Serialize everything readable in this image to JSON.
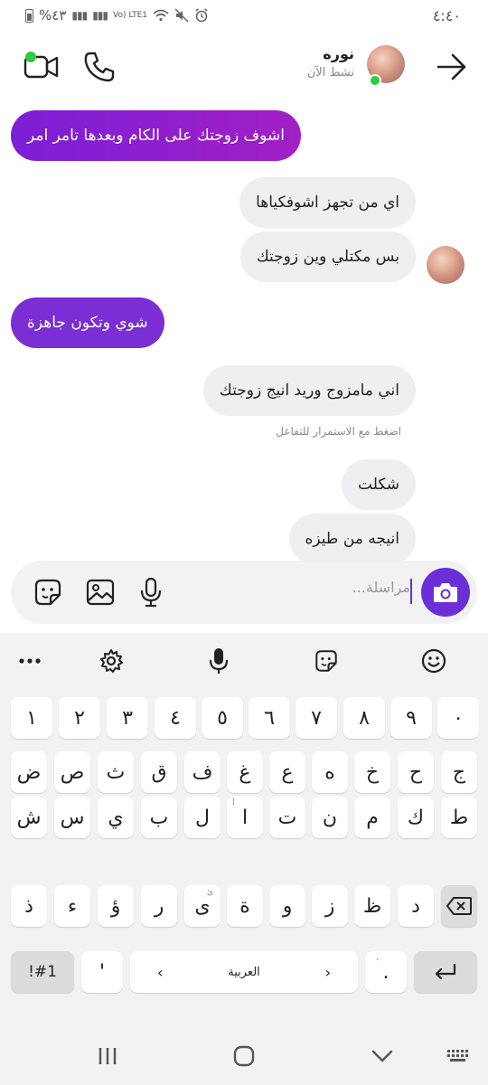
{
  "status_bar": {
    "time": "٤:٤٠",
    "battery": "%٤٣",
    "network": "Vo) LTE1"
  },
  "header": {
    "contact_name": "نوره",
    "contact_status": "نشط الآن"
  },
  "messages": [
    {
      "direction": "out",
      "text": "اشوف زوجتك على الكام وبعدها تامر امر"
    },
    {
      "direction": "in",
      "text": "اي من تجهز اشوفكياها"
    },
    {
      "direction": "in",
      "text": "بس مكتلي وين زوجتك"
    },
    {
      "direction": "out",
      "text": "شوي وتكون جاهزة"
    },
    {
      "direction": "in",
      "text": "اني مامزوج وريد انيج زوجتك"
    },
    {
      "direction": "in",
      "text": "شكلت"
    },
    {
      "direction": "in",
      "text": "انيجه من طيزه"
    }
  ],
  "hint": "اضغط مع الاستمرار للتفاعل",
  "composer": {
    "placeholder": "مراسلة..."
  },
  "keyboard": {
    "toolbar": [
      "more-icon",
      "gear-icon",
      "mic-icon",
      "sticker-icon",
      "emoji-icon"
    ],
    "row_numbers": [
      "١",
      "٢",
      "٣",
      "٤",
      "٥",
      "٦",
      "٧",
      "٨",
      "٩",
      "٠"
    ],
    "row1": [
      "ض",
      "ص",
      "ث",
      "ق",
      "ف",
      "غ",
      "ع",
      "ه",
      "خ",
      "ح",
      "ج"
    ],
    "row2": [
      "ش",
      "س",
      "ي",
      "ب",
      "ل",
      "ا",
      "ت",
      "ن",
      "م",
      "ك",
      "ط"
    ],
    "row2_hint": "أ",
    "row3": [
      "ذ",
      "ء",
      "ؤ",
      "ر",
      "ى",
      "ة",
      "و",
      "ز",
      "ظ",
      "د"
    ],
    "row3_hint": "ئ",
    "symbols": "!#1",
    "apostrophe": "'",
    "space_label": "العربية",
    "period": ".",
    "period_hint": "،"
  },
  "colors": {
    "accent": "#7b1fd6",
    "online": "#2ecc40",
    "bubble_in": "#efeff1"
  }
}
